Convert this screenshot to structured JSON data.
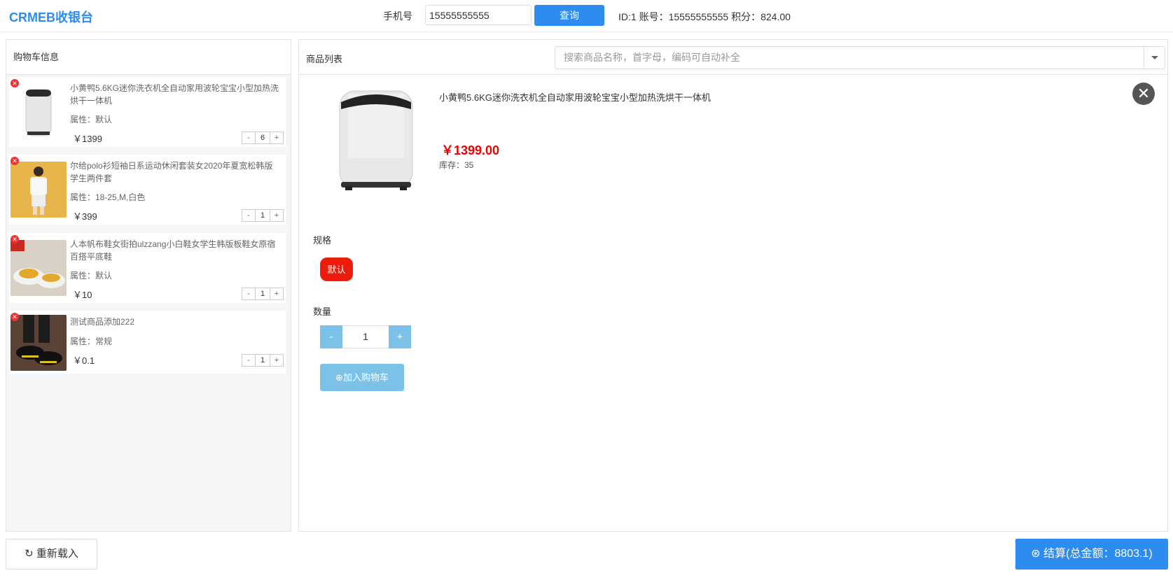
{
  "header": {
    "logo": "CRMEB收银台",
    "phone_label": "手机号",
    "phone_value": "15555555555",
    "query_label": "查询",
    "user_info": "ID:1 账号：15555555555 积分：824.00"
  },
  "cart": {
    "title": "购物车信息",
    "items": [
      {
        "name": "小黄鸭5.6KG迷你洗衣机全自动家用波轮宝宝小型加热洗烘干一体机",
        "attr": "属性：默认",
        "price": "￥1399",
        "qty": "6"
      },
      {
        "name": "尔给polo衫短袖日系运动休闲套装女2020年夏宽松韩版学生两件套",
        "attr": "属性：18-25,M,白色",
        "price": "￥399",
        "qty": "1"
      },
      {
        "name": "人本帆布鞋女街拍ulzzang小白鞋女学生韩版板鞋女原宿百搭平底鞋",
        "attr": "属性：默认",
        "price": "￥10",
        "qty": "1"
      },
      {
        "name": "测试商品添加222",
        "attr": "属性：常规",
        "price": "￥0.1",
        "qty": "1"
      }
    ]
  },
  "product": {
    "title": "商品列表",
    "search_placeholder": "搜索商品名称，首字母，编码可自动补全",
    "detail": {
      "name": "小黄鸭5.6KG迷你洗衣机全自动家用波轮宝宝小型加热洗烘干一体机",
      "price": "￥1399.00",
      "stock": "库存：35",
      "spec_label": "规格",
      "spec_option": "默认",
      "qty_label": "数量",
      "qty_value": "1",
      "add_cart_label": "加入购物车"
    }
  },
  "footer": {
    "reload_label": "重新载入",
    "checkout_label": "结算(总金额：8803.1)"
  }
}
